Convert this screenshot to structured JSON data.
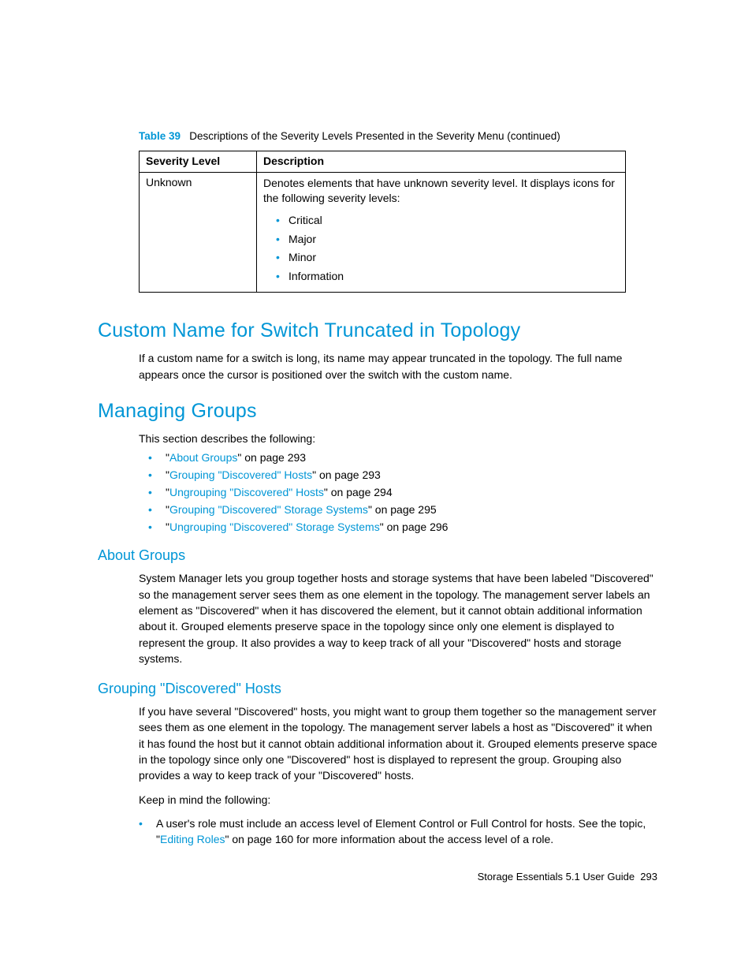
{
  "table": {
    "caption_label": "Table 39",
    "caption_text": "Descriptions of the Severity Levels Presented in the Severity Menu (continued)",
    "col1_header": "Severity Level",
    "col2_header": "Description",
    "row1_level": "Unknown",
    "row1_desc_intro": "Denotes elements that have unknown severity level. It displays icons for the following severity levels:",
    "row1_items": {
      "a": "Critical",
      "b": "Major",
      "c": "Minor",
      "d": "Information"
    }
  },
  "section1": {
    "heading": "Custom Name for Switch Truncated in Topology",
    "para": "If a custom name for a switch is long, its name may appear truncated in the topology. The full name appears once the cursor is positioned over the switch with the custom name."
  },
  "section2": {
    "heading": "Managing Groups",
    "intro": "This section describes the following:",
    "toc": {
      "a": {
        "q1": "\"",
        "link": "About Groups",
        "tail": "\" on page 293"
      },
      "b": {
        "q1": "\"",
        "link": "Grouping \"Discovered\" Hosts",
        "tail": "\" on page 293"
      },
      "c": {
        "q1": "\"",
        "link": "Ungrouping \"Discovered\" Hosts",
        "tail": "\" on page 294"
      },
      "d": {
        "q1": "\"",
        "link": "Grouping \"Discovered\" Storage Systems",
        "tail": "\" on page 295"
      },
      "e": {
        "q1": "\"",
        "link": "Ungrouping \"Discovered\" Storage Systems",
        "tail": "\" on page 296"
      }
    }
  },
  "sub1": {
    "heading": "About Groups",
    "para": "System Manager lets you group together hosts and storage systems that have been labeled \"Discovered\" so the management server sees them as one element in the topology. The management server labels an element as \"Discovered\" when it has discovered the element, but it cannot obtain additional information about it. Grouped elements preserve space in the topology since only one element is displayed to represent the group. It also provides a way to keep track of all your \"Discovered\" hosts and storage systems."
  },
  "sub2": {
    "heading": "Grouping \"Discovered\" Hosts",
    "para1": "If you have several \"Discovered\" hosts, you might want to group them together so the management server sees them as one element in the topology. The management server labels a host as \"Discovered\" it when it has found the host but it cannot obtain additional information about it. Grouped elements preserve space in the topology since only one \"Discovered\" host is displayed to represent the group. Grouping also provides a way to keep track of your \"Discovered\" hosts.",
    "para2": "Keep in mind the following:",
    "fact1_pre": "A user's role must include an access level of Element Control or Full Control for hosts. See the topic, \"",
    "fact1_link": "Editing Roles",
    "fact1_post": "\" on page 160 for more information about the access level of a role."
  },
  "footer": {
    "title": "Storage Essentials 5.1 User Guide",
    "page": "293"
  }
}
